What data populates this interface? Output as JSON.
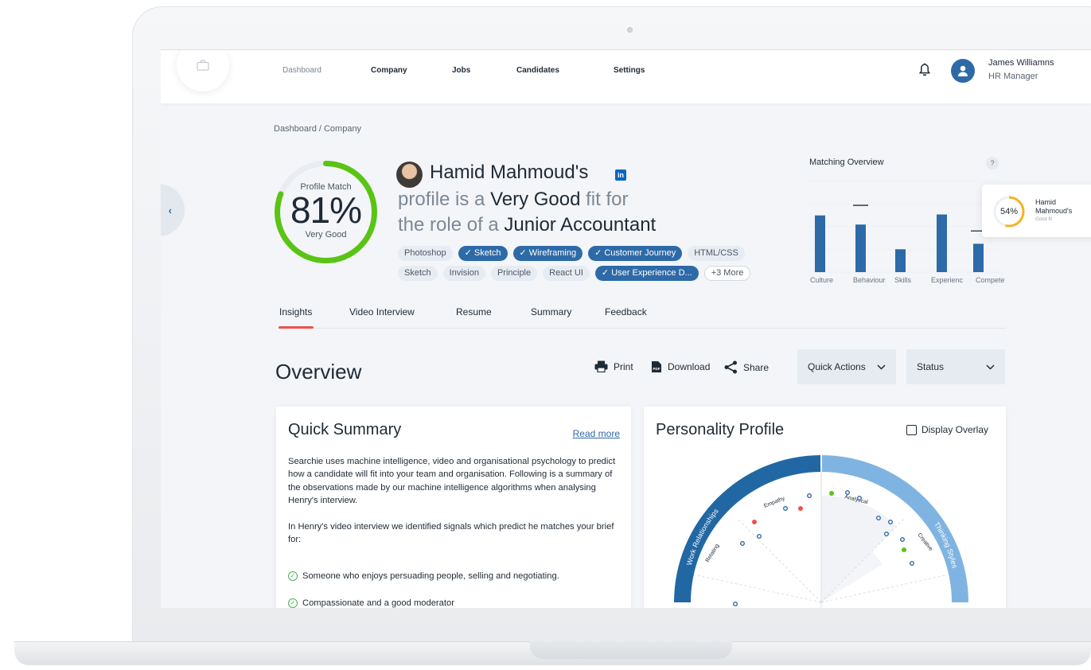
{
  "nav": {
    "items": [
      "Dashboard",
      "Company",
      "Jobs",
      "Candidates",
      "Settings"
    ],
    "user_name": "James Williamns",
    "user_role": "HR Manager"
  },
  "breadcrumb": "Dashboard / Company",
  "match": {
    "label": "Profile Match",
    "value": "81%",
    "rating": "Very Good",
    "percent": 81,
    "color": "#5ac414"
  },
  "headline": {
    "name": "Hamid Mahmoud's",
    "linkedin": "in",
    "line2_prefix": "profile is a ",
    "line2_bold": "Very Good",
    "line2_suffix": " fit for",
    "line3_prefix": "the role of a ",
    "line3_bold": "Junior Accountant"
  },
  "tags": [
    {
      "label": "Photoshop",
      "selected": false
    },
    {
      "label": "✓ Sketch",
      "selected": true
    },
    {
      "label": "✓ Wireframing",
      "selected": true
    },
    {
      "label": "✓ Customer Journey",
      "selected": true
    },
    {
      "label": "HTML/CSS",
      "selected": false
    },
    {
      "label": "Sketch",
      "selected": false
    },
    {
      "label": "Invision",
      "selected": false
    },
    {
      "label": "Principle",
      "selected": false
    },
    {
      "label": "React UI",
      "selected": false
    },
    {
      "label": "✓ User Experience D...",
      "selected": true
    },
    {
      "label": "+3 More",
      "selected": false,
      "more": true
    }
  ],
  "matching_overview": {
    "title": "Matching Overview",
    "help": "?",
    "popup": {
      "percent_label": "54%",
      "percent": 54,
      "name": "Hamid Mahmoud's",
      "sub": "Good fit"
    }
  },
  "chart_data": {
    "type": "bar",
    "categories": [
      "Culture",
      "Behaviour",
      "Skills",
      "Experienc",
      "Compete"
    ],
    "values": [
      0.62,
      0.52,
      0.25,
      0.63,
      0.31
    ],
    "benchmark": [
      null,
      0.73,
      null,
      null,
      0.45
    ],
    "ylim": [
      0,
      1
    ],
    "bar_color": "#2d6aa7"
  },
  "tabs": [
    "Insights",
    "Video Interview",
    "Resume",
    "Summary",
    "Feedback"
  ],
  "active_tab": "Insights",
  "overview": {
    "title": "Overview",
    "print": "Print",
    "download": "Download",
    "share": "Share",
    "quick_actions": "Quick Actions",
    "status": "Status"
  },
  "quick_summary": {
    "title": "Quick Summary",
    "read_more": "Read more",
    "para1": "Searchie uses machine intelligence, video and organisational psychology to predict how a candidate will fit into your team and organisation. Following is a summary of the observations made by our machine intelligence algorithms when analysing Henry's interview.",
    "para2": "In Henry's video interview we identified signals which predict he matches your brief for:",
    "bullets": [
      "Someone who enjoys persuading people, selling and negotiating.",
      "Compassionate and a good moderator"
    ]
  },
  "personality": {
    "title": "Personality Profile",
    "overlay": "Display Overlay",
    "left_arc": "Work Relationships",
    "right_arc": "Thinking Styles",
    "labels": [
      "Empathy",
      "Relating",
      "Analytical",
      "Creative"
    ],
    "left_color": "#2167a3",
    "right_color": "#7fb4e2"
  }
}
